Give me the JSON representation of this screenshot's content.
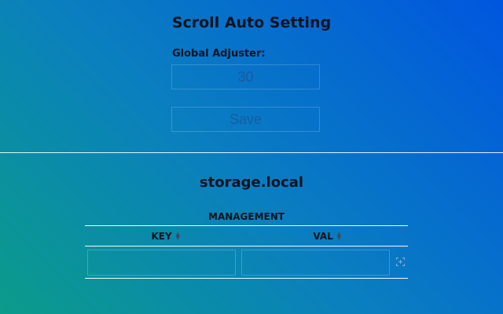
{
  "header": {
    "title": "Scroll Auto Setting"
  },
  "global_adjuster": {
    "label": "Global Adjuster:",
    "value": "30",
    "save_label": "Save"
  },
  "storage": {
    "title": "storage.local",
    "table": {
      "caption": "MANAGEMENT",
      "columns": [
        "KEY",
        "VAL"
      ],
      "new_row": {
        "key": "",
        "val": ""
      }
    }
  },
  "icons": {
    "sort": "sort-arrows-icon",
    "add": "add-row-icon"
  }
}
